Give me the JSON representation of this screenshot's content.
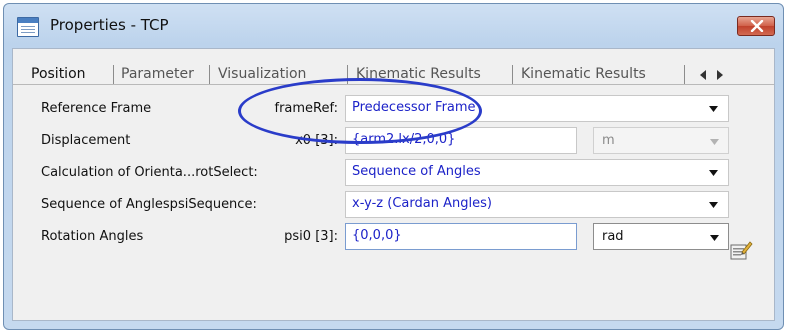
{
  "window": {
    "title": "Properties - TCP",
    "icons": {
      "app": "properties-window-icon",
      "close": "close-icon"
    }
  },
  "tabs": [
    {
      "label": "Position",
      "active": true
    },
    {
      "label": "Parameter",
      "active": false
    },
    {
      "label": "Visualization",
      "active": false
    },
    {
      "label": "Kinematic Results",
      "active": false
    },
    {
      "label": "Kinematic Results",
      "active": false
    }
  ],
  "tab_scroll": {
    "left_icon": "triangle-left-icon",
    "right_icon": "triangle-right-icon"
  },
  "rows": [
    {
      "label": "Reference Frame",
      "param": "frameRef:",
      "value": "Predecessor Frame"
    },
    {
      "label": "Displacement",
      "param": "x0 [3]:",
      "value": "{arm2.lx/2,0,0}",
      "unit": "m",
      "unit_enabled": false
    },
    {
      "label": "Calculation of Orienta...rotSelect:",
      "param": "",
      "value": "Sequence of Angles"
    },
    {
      "label": "Sequence of AnglespsiSequence:",
      "param": "",
      "value": "x-y-z (Cardan Angles)"
    },
    {
      "label": "Rotation Angles",
      "param": "psi0 [3]:",
      "value": "{0,0,0}",
      "unit": "rad",
      "unit_enabled": true
    }
  ],
  "colors": {
    "value_text": "#1c22c8",
    "highlight_ellipse": "#2a3cc9",
    "close_button": "#c0412c"
  },
  "icons": {
    "dropdown": "dropdown-arrow-icon",
    "properties_button": "properties-editor-icon"
  }
}
